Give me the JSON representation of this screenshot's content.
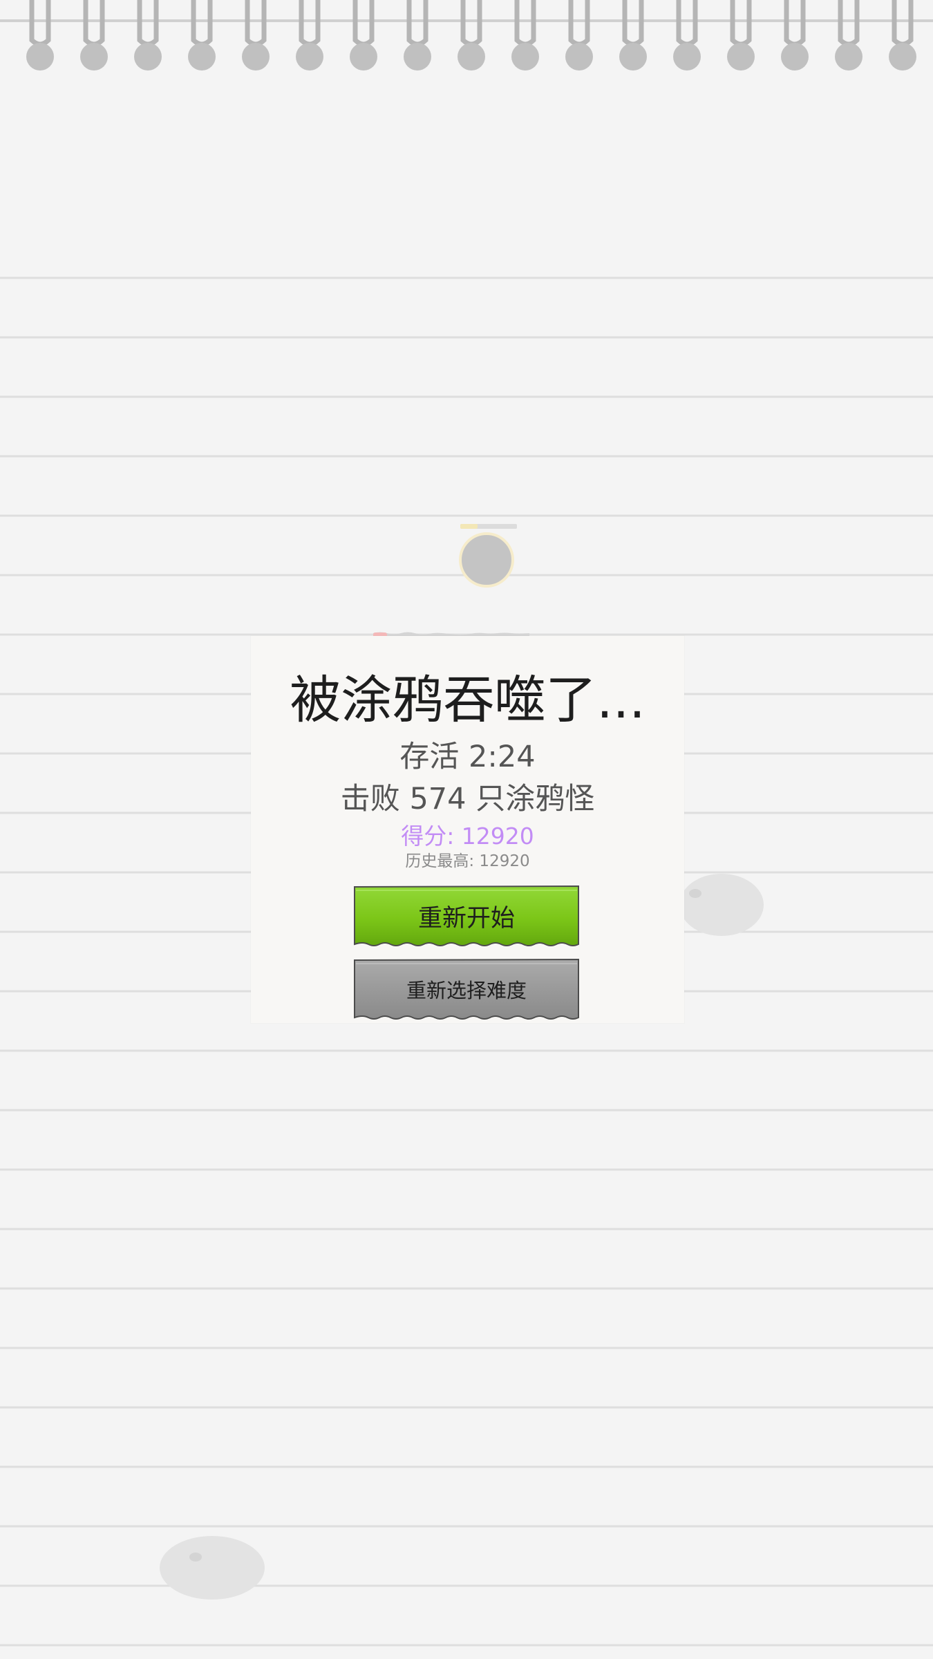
{
  "game_over": {
    "title": "被涂鸦吞噬了...",
    "survive_text": "存活 2:24",
    "kills_text": "击败 574 只涂鸦怪",
    "score_text": "得分: 12920",
    "best_text": "历史最高: 12920",
    "restart_label": "重新开始",
    "difficulty_label": "重新选择难度"
  },
  "player": {
    "hp_fraction": 0.3
  },
  "colors": {
    "paper": "#f4f4f4",
    "ruled_line": "#dedede",
    "restart_button": "#7cc618",
    "difficulty_button": "#9a9a9a",
    "score_text": "#c28cf5"
  }
}
